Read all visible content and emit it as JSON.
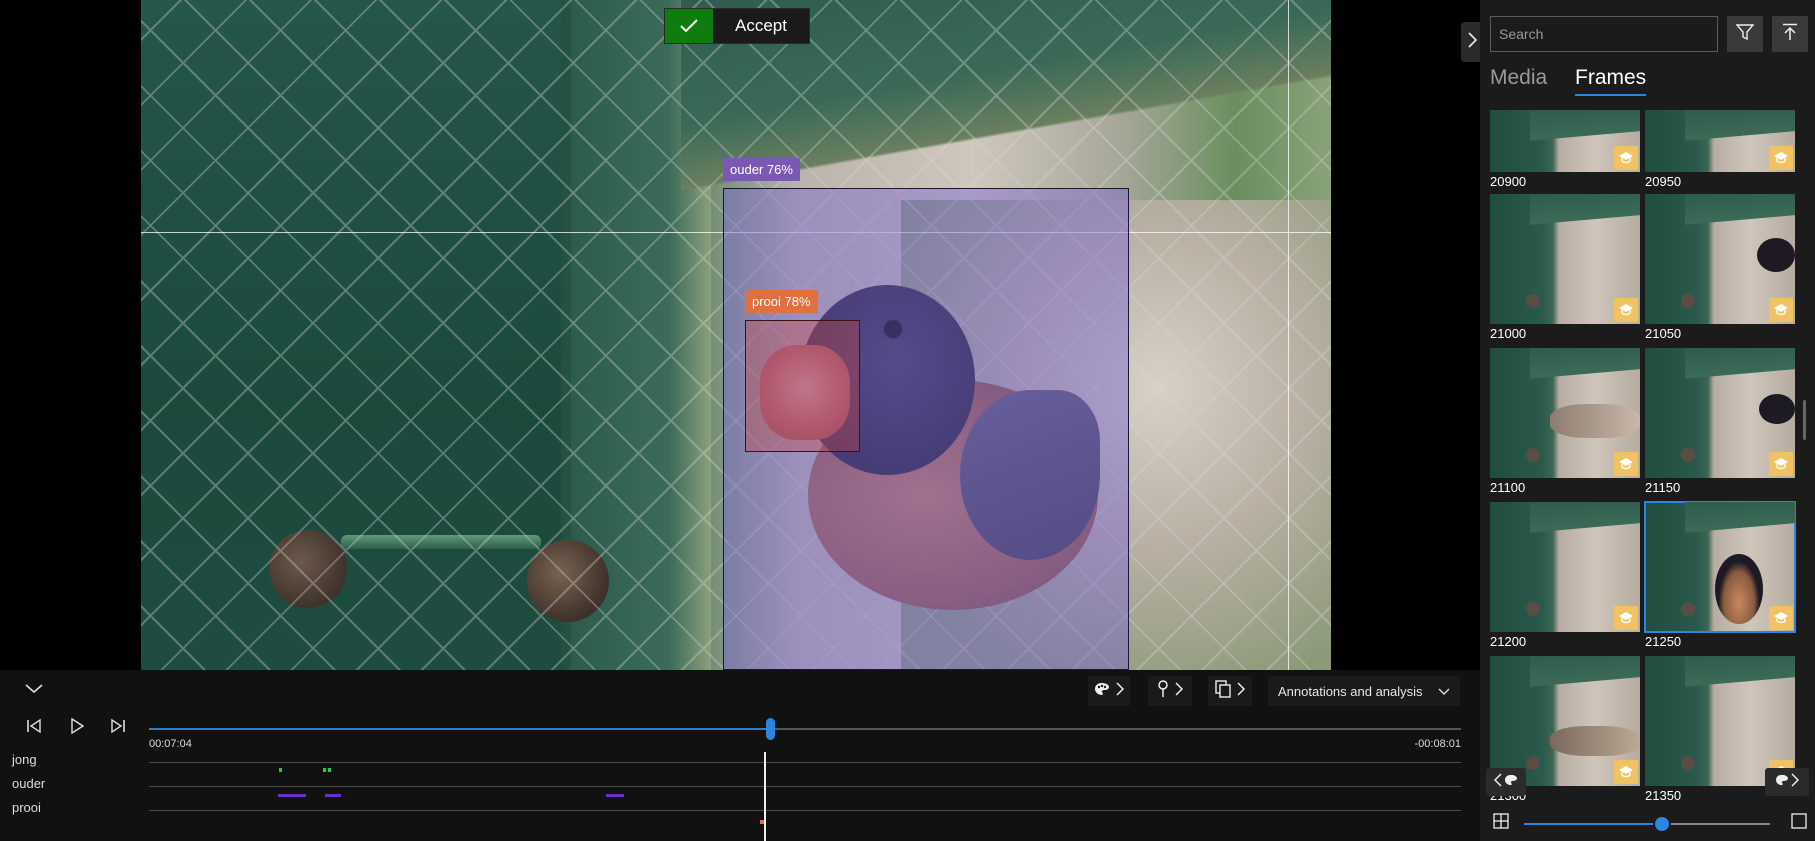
{
  "viewer": {
    "accept_label": "Accept",
    "annotations": [
      {
        "label": "ouder",
        "score": "76%"
      },
      {
        "label": "prooi",
        "score": "78%"
      }
    ]
  },
  "timeline": {
    "mode_label": "Annotations and analysis",
    "time_current": "00:07:04",
    "time_remaining": "-00:08:01",
    "progress": 0.473,
    "tracks": [
      {
        "name": "jong",
        "color": "#22cc44"
      },
      {
        "name": "ouder",
        "color": "#6a2fd0"
      },
      {
        "name": "prooi",
        "color": "#e0703f"
      }
    ]
  },
  "sidebar": {
    "search_placeholder": "Search",
    "tabs": [
      {
        "label": "Media",
        "active": false
      },
      {
        "label": "Frames",
        "active": true
      }
    ],
    "frames": [
      "20900",
      "20950",
      "21000",
      "21050",
      "21100",
      "21150",
      "21200",
      "21250",
      "21300",
      "21350"
    ],
    "selected_frame": "21250",
    "thumbnail_size": 0.56
  },
  "icons": {
    "accept": "checkmark-icon",
    "collapse": "chevron-down-icon",
    "palette": "palette-icon",
    "pin": "pin-icon",
    "copy": "copy-icon",
    "prev": "skip-back-icon",
    "play": "play-icon",
    "next": "skip-forward-icon",
    "filter": "filter-icon",
    "scroll_top": "scroll-to-top-icon",
    "badge": "graduation-cap-icon",
    "grid": "grid-view-icon",
    "single": "single-view-icon"
  },
  "colors": {
    "accent": "#2a86e0",
    "accept_green": "#107c10",
    "ouder_label": "#7b58b4",
    "prooi_label": "#e0703f",
    "badge": "#f0c262"
  }
}
